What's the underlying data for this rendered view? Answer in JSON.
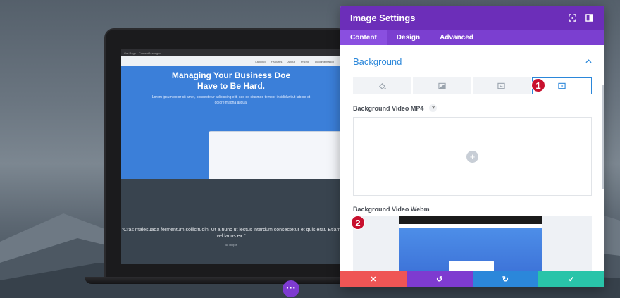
{
  "panel": {
    "title": "Image Settings",
    "tabs": [
      "Content",
      "Design",
      "Advanced"
    ],
    "section_title": "Background",
    "field_mp4_label": "Background Video MP4",
    "field_webm_label": "Background Video Webm",
    "help_glyph": "?",
    "add_glyph": "+",
    "footer": {
      "cancel": "✕",
      "undo": "↺",
      "redo": "↻",
      "save": "✓"
    }
  },
  "annotations": [
    "1",
    "2"
  ],
  "site": {
    "browser_tabs": [
      "Get Page",
      "Content Manager"
    ],
    "nav": [
      "Landing",
      "Features",
      "About",
      "Pricing",
      "Documentation"
    ],
    "hero_title_1": "Managing Your Business Doe",
    "hero_title_2": "Have to Be Hard.",
    "hero_text": "Lorem ipsum dolor sit amet, consectetur adipiscing elit, sed do eiusmod tempor incididunt ut labore et dolore magna aliqua.",
    "quote": "\"Cras malesuada fermentum sollicitudin. Ut a nunc ut lectus interdum consectetur et quis erat. Etiam vel lacus ex.\"",
    "quote_by": "Bo Ripple"
  },
  "colors": {
    "header": "#6c2eb9",
    "tabs": "#7b3fd0",
    "accent": "#2b87da",
    "cancel": "#ef5555",
    "save": "#29c4a9",
    "badge": "#c8102e"
  }
}
